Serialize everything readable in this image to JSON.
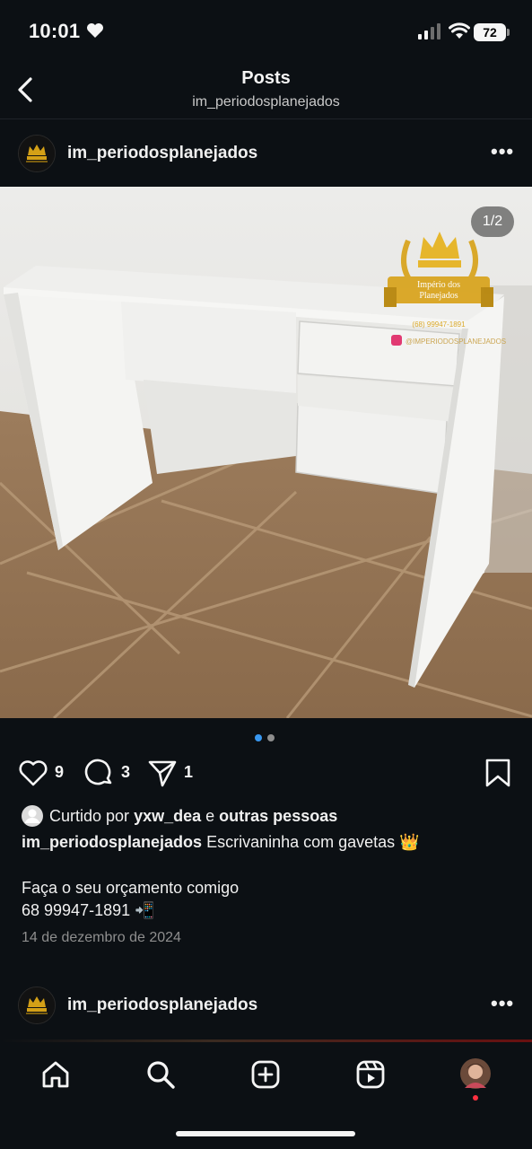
{
  "status_bar": {
    "time": "10:01",
    "battery": "72"
  },
  "header": {
    "title": "Posts",
    "subtitle": "im_periodosplanejados"
  },
  "post": {
    "username": "im_periodosplanejados",
    "image_counter": "1/2",
    "likes": "9",
    "comments": "3",
    "shares": "1",
    "liked_by_prefix": "Curtido por",
    "liked_by_user": "yxw_dea",
    "liked_by_conj": "e",
    "liked_by_others": "outras pessoas",
    "caption_user": "im_periodosplanejados",
    "caption_text": "Escrivaninha com gavetas 👑",
    "caption_line2": "Faça o seu orçamento comigo",
    "caption_line3": "68 99947-1891 📲",
    "date": "14 de dezembro de 2024",
    "watermark_lines": [
      "Império dos",
      "Planejados",
      "(68) 99947-1891",
      "@IMPERIODOSPLANEJADOS"
    ]
  },
  "next_post": {
    "username": "im_periodosplanejados"
  },
  "colors": {
    "background": "#0c1014",
    "accent_blue": "#3897f0",
    "muted": "#8e8e8e"
  },
  "icons": [
    "heart-icon",
    "comment-icon",
    "share-icon",
    "bookmark-icon",
    "home-icon",
    "search-icon",
    "create-icon",
    "reels-icon",
    "profile-avatar"
  ]
}
